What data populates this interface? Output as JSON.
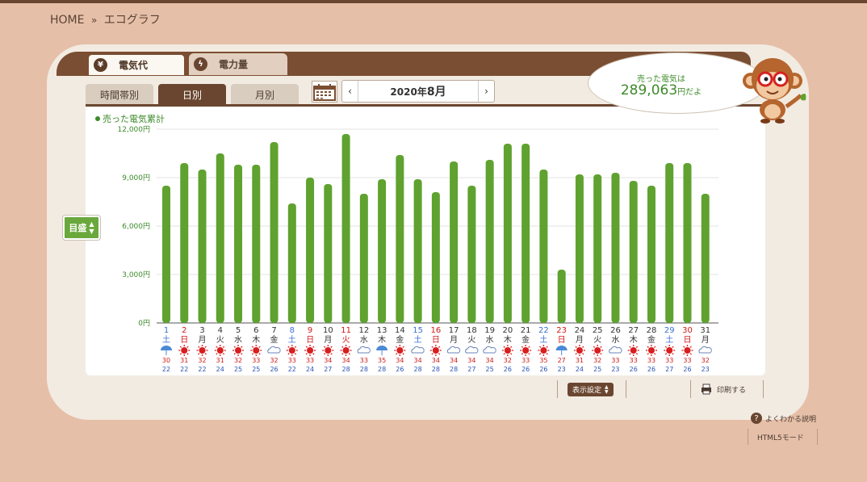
{
  "breadcrumb": {
    "home": "HOME",
    "sep": "»",
    "current": "エコグラフ"
  },
  "top_tabs": [
    {
      "label": "電気代",
      "icon": "yen-icon",
      "active": true
    },
    {
      "label": "電力量",
      "icon": "bolt-icon",
      "active": false
    }
  ],
  "sub_tabs": [
    {
      "label": "時間帯別",
      "active": false
    },
    {
      "label": "日別",
      "active": true
    },
    {
      "label": "月別",
      "active": false
    }
  ],
  "month_nav": {
    "year": "2020年",
    "month": "8月",
    "prev": "‹",
    "next": "›"
  },
  "bubble": {
    "line1": "売った電気は",
    "amount": "289,063",
    "suffix": "円だよ"
  },
  "legend": "売った電気累計",
  "meter_button": "目盛",
  "display_settings": "表示設定",
  "print": "印刷する",
  "help": "よくわかる説明",
  "html5": "HTML5モード",
  "colors": {
    "bar": "#5fa22f",
    "frame_bg": "#f2ebe2",
    "page_bg": "#e6bfa8",
    "brown": "#6a4630",
    "sat": "#3a6fd0",
    "sun": "#d01a1a",
    "weekday": "#333333"
  },
  "chart_data": {
    "type": "bar",
    "ylim": [
      0,
      12000
    ],
    "yticks": [
      "0円",
      "3,000円",
      "6,000円",
      "9,000円",
      "12,000円"
    ],
    "ytick_values": [
      0,
      3000,
      6000,
      9000,
      12000
    ],
    "categories": [
      "1",
      "2",
      "3",
      "4",
      "5",
      "6",
      "7",
      "8",
      "9",
      "10",
      "11",
      "12",
      "13",
      "14",
      "15",
      "16",
      "17",
      "18",
      "19",
      "20",
      "21",
      "22",
      "23",
      "24",
      "25",
      "26",
      "27",
      "28",
      "29",
      "30",
      "31"
    ],
    "weekdays": [
      "土",
      "日",
      "月",
      "火",
      "水",
      "木",
      "金",
      "土",
      "日",
      "月",
      "火",
      "水",
      "木",
      "金",
      "土",
      "日",
      "月",
      "火",
      "水",
      "木",
      "金",
      "土",
      "日",
      "月",
      "火",
      "水",
      "木",
      "金",
      "土",
      "日",
      "月"
    ],
    "day_type": [
      "sat",
      "sun",
      "w",
      "w",
      "w",
      "w",
      "w",
      "sat",
      "sun",
      "w",
      "sun",
      "w",
      "w",
      "w",
      "sat",
      "sun",
      "w",
      "w",
      "w",
      "w",
      "w",
      "sat",
      "sun",
      "w",
      "w",
      "w",
      "w",
      "w",
      "sat",
      "sun",
      "w"
    ],
    "weather": [
      "rain",
      "sun",
      "sun",
      "sun",
      "sun",
      "sun",
      "cloud",
      "sun",
      "sun",
      "sun",
      "sun",
      "cloud",
      "rain",
      "sun",
      "cloud",
      "sun",
      "cloud",
      "cloud",
      "cloud",
      "sun",
      "sun",
      "sun",
      "rain",
      "sun",
      "sun",
      "cloud",
      "sun",
      "sun",
      "sun",
      "sun",
      "cloud"
    ],
    "temp_high": [
      "30",
      "31",
      "32",
      "31",
      "32",
      "33",
      "32",
      "33",
      "33",
      "34",
      "34",
      "33",
      "35",
      "34",
      "34",
      "34",
      "34",
      "34",
      "34",
      "32",
      "33",
      "35",
      "27",
      "31",
      "32",
      "33",
      "33",
      "33",
      "33",
      "33",
      "32"
    ],
    "temp_low": [
      "22",
      "22",
      "22",
      "24",
      "25",
      "25",
      "26",
      "22",
      "24",
      "27",
      "28",
      "28",
      "28",
      "26",
      "28",
      "28",
      "28",
      "27",
      "25",
      "26",
      "26",
      "26",
      "23",
      "24",
      "25",
      "23",
      "26",
      "26",
      "27",
      "26",
      "23"
    ],
    "values": [
      8500,
      9900,
      9500,
      10500,
      9800,
      9800,
      11200,
      7400,
      9000,
      8600,
      11700,
      8000,
      8900,
      10400,
      8900,
      8100,
      10000,
      8500,
      10100,
      11100,
      11100,
      9500,
      3300,
      9200,
      9200,
      9300,
      8800,
      8500,
      9900,
      9900,
      8000
    ],
    "series": [
      {
        "name": "売った電気累計"
      }
    ]
  }
}
